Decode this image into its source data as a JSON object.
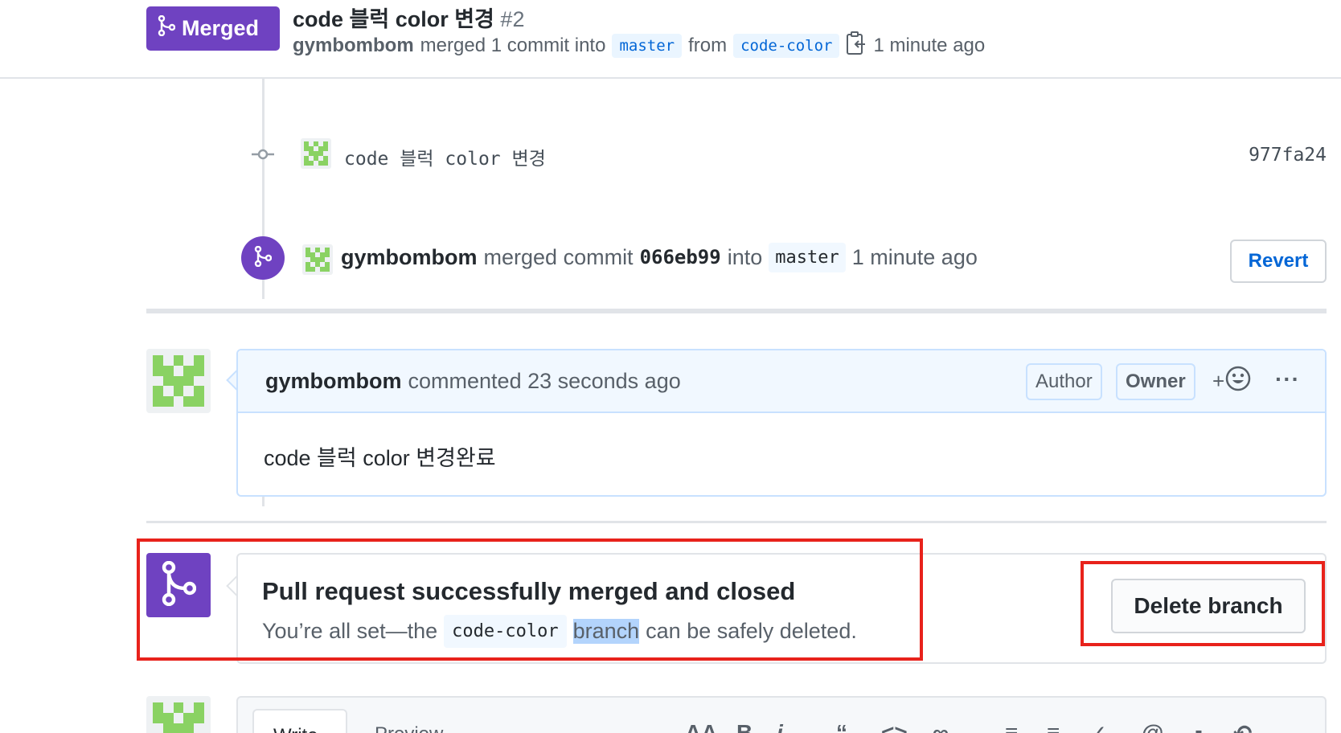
{
  "header": {
    "state_label": "Merged",
    "title": "code 블럭 color 변경",
    "number": "#2",
    "author": "gymbombom",
    "merged_text": "merged 1 commit into",
    "base_branch": "master",
    "from_text": "from",
    "head_branch": "code-color",
    "time": "1 minute ago"
  },
  "commit": {
    "message": "code 블럭 color 변경",
    "sha": "977fa24"
  },
  "merge_event": {
    "author": "gymbombom",
    "text": "merged commit",
    "sha": "066eb99",
    "into": "into",
    "branch": "master",
    "time": "1 minute ago",
    "revert_label": "Revert"
  },
  "comment": {
    "author": "gymbombom",
    "meta": "commented 23 seconds ago",
    "role_author": "Author",
    "role_owner": "Owner",
    "react_plus": "+",
    "more": "···",
    "body": "code 블럭 color 변경완료"
  },
  "merge_status": {
    "title": "Pull request successfully merged and closed",
    "desc_prefix": "You’re all set—the",
    "branch": "code-color",
    "highlight": "branch",
    "desc_suffix": "can be safely deleted.",
    "delete_label": "Delete branch"
  },
  "composer": {
    "write_tab": "Write",
    "preview_tab": "Preview"
  },
  "colors": {
    "merged_purple": "#6f42c1",
    "link_blue": "#0366d6",
    "annotation_red": "#e8221b"
  }
}
